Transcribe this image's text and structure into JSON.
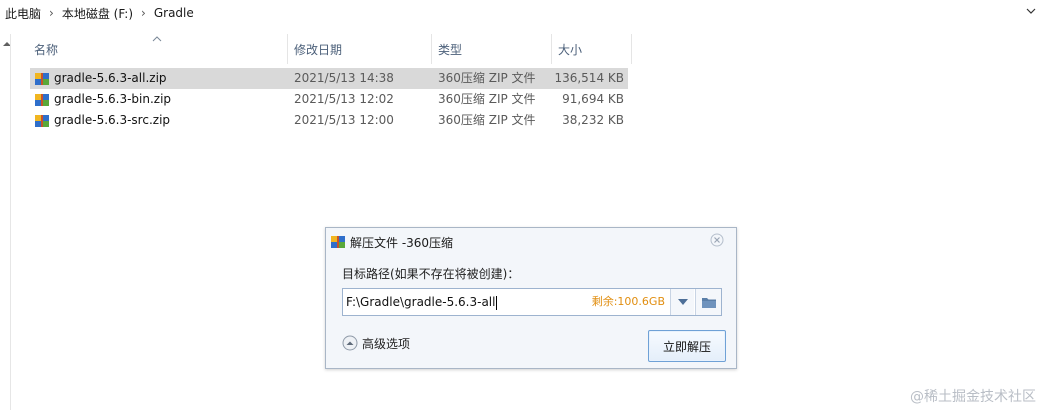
{
  "breadcrumb": [
    "此电脑",
    "本地磁盘 (F:)",
    "Gradle"
  ],
  "columns": {
    "name": "名称",
    "date": "修改日期",
    "type": "类型",
    "size": "大小"
  },
  "files": [
    {
      "name": "gradle-5.6.3-all.zip",
      "date": "2021/5/13 14:38",
      "type": "360压缩 ZIP 文件",
      "size": "136,514 KB",
      "selected": true
    },
    {
      "name": "gradle-5.6.3-bin.zip",
      "date": "2021/5/13 12:02",
      "type": "360压缩 ZIP 文件",
      "size": "91,694 KB",
      "selected": false
    },
    {
      "name": "gradle-5.6.3-src.zip",
      "date": "2021/5/13 12:00",
      "type": "360压缩 ZIP 文件",
      "size": "38,232 KB",
      "selected": false
    }
  ],
  "dialog": {
    "title": "解压文件 -360压缩",
    "path_label": "目标路径(如果不存在将被创建)：",
    "path_value": "F:\\Gradle\\gradle-5.6.3-all",
    "free_space": "剩余:100.6GB",
    "advanced_label": "高级选项",
    "extract_button": "立即解压"
  },
  "watermark": "@稀土掘金技术社区",
  "icons": {
    "breadcrumb_separator": "chevron-right-icon",
    "expand": "chevron-down-icon",
    "file": "zip-archive-icon",
    "close": "close-icon",
    "dropdown": "triangle-down-icon",
    "browse": "folder-icon",
    "advanced": "chevron-up-circle-icon"
  },
  "colors": {
    "accent": "#e18e10",
    "selection": "#d9d9d9",
    "dialog_bg": "#f3f6fa",
    "button_border": "#6fa1d6"
  }
}
